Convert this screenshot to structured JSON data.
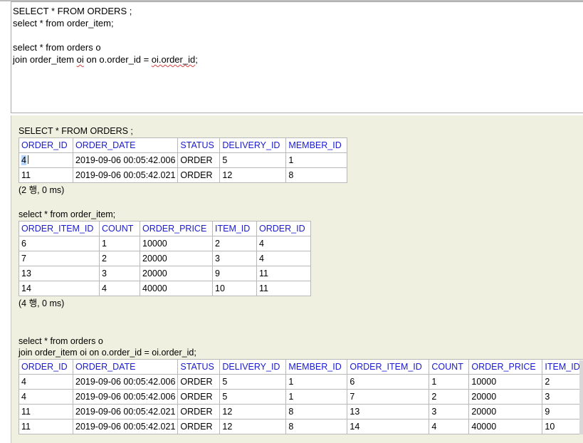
{
  "editor": {
    "lines": [
      "SELECT * FROM ORDERS ;",
      "select * from order_item;",
      "",
      "select * from orders o",
      "join order_item oi on o.order_id = oi.order_id;"
    ]
  },
  "results": [
    {
      "query_lines": [
        "SELECT * FROM ORDERS ;"
      ],
      "columns": [
        "ORDER_ID",
        "ORDER_DATE",
        "STATUS",
        "DELIVERY_ID",
        "MEMBER_ID"
      ],
      "rows": [
        [
          "4",
          "2019-09-06 00:05:42.006",
          "ORDER",
          "5",
          "1"
        ],
        [
          "11",
          "2019-09-06 00:05:42.021",
          "ORDER",
          "12",
          "8"
        ]
      ],
      "summary": "(2 행, 0 ms)"
    },
    {
      "query_lines": [
        "select * from order_item;"
      ],
      "columns": [
        "ORDER_ITEM_ID",
        "COUNT",
        "ORDER_PRICE",
        "ITEM_ID",
        "ORDER_ID"
      ],
      "rows": [
        [
          "6",
          "1",
          "10000",
          "2",
          "4"
        ],
        [
          "7",
          "2",
          "20000",
          "3",
          "4"
        ],
        [
          "13",
          "3",
          "20000",
          "9",
          "11"
        ],
        [
          "14",
          "4",
          "40000",
          "10",
          "11"
        ]
      ],
      "summary": "(4 행, 0 ms)"
    },
    {
      "query_lines": [
        "select * from orders o",
        "join order_item oi on o.order_id = oi.order_id;"
      ],
      "columns": [
        "ORDER_ID",
        "ORDER_DATE",
        "STATUS",
        "DELIVERY_ID",
        "MEMBER_ID",
        "ORDER_ITEM_ID",
        "COUNT",
        "ORDER_PRICE",
        "ITEM_ID"
      ],
      "rows": [
        [
          "4",
          "2019-09-06 00:05:42.006",
          "ORDER",
          "5",
          "1",
          "6",
          "1",
          "10000",
          "2"
        ],
        [
          "4",
          "2019-09-06 00:05:42.006",
          "ORDER",
          "5",
          "1",
          "7",
          "2",
          "20000",
          "3"
        ],
        [
          "11",
          "2019-09-06 00:05:42.021",
          "ORDER",
          "12",
          "8",
          "13",
          "3",
          "20000",
          "9"
        ],
        [
          "11",
          "2019-09-06 00:05:42.021",
          "ORDER",
          "12",
          "8",
          "14",
          "4",
          "40000",
          "10"
        ]
      ]
    }
  ],
  "colors": {
    "header_text": "#1a1ad0",
    "results_bg": "#f0f0e0",
    "selection": "#b5d5ff"
  }
}
